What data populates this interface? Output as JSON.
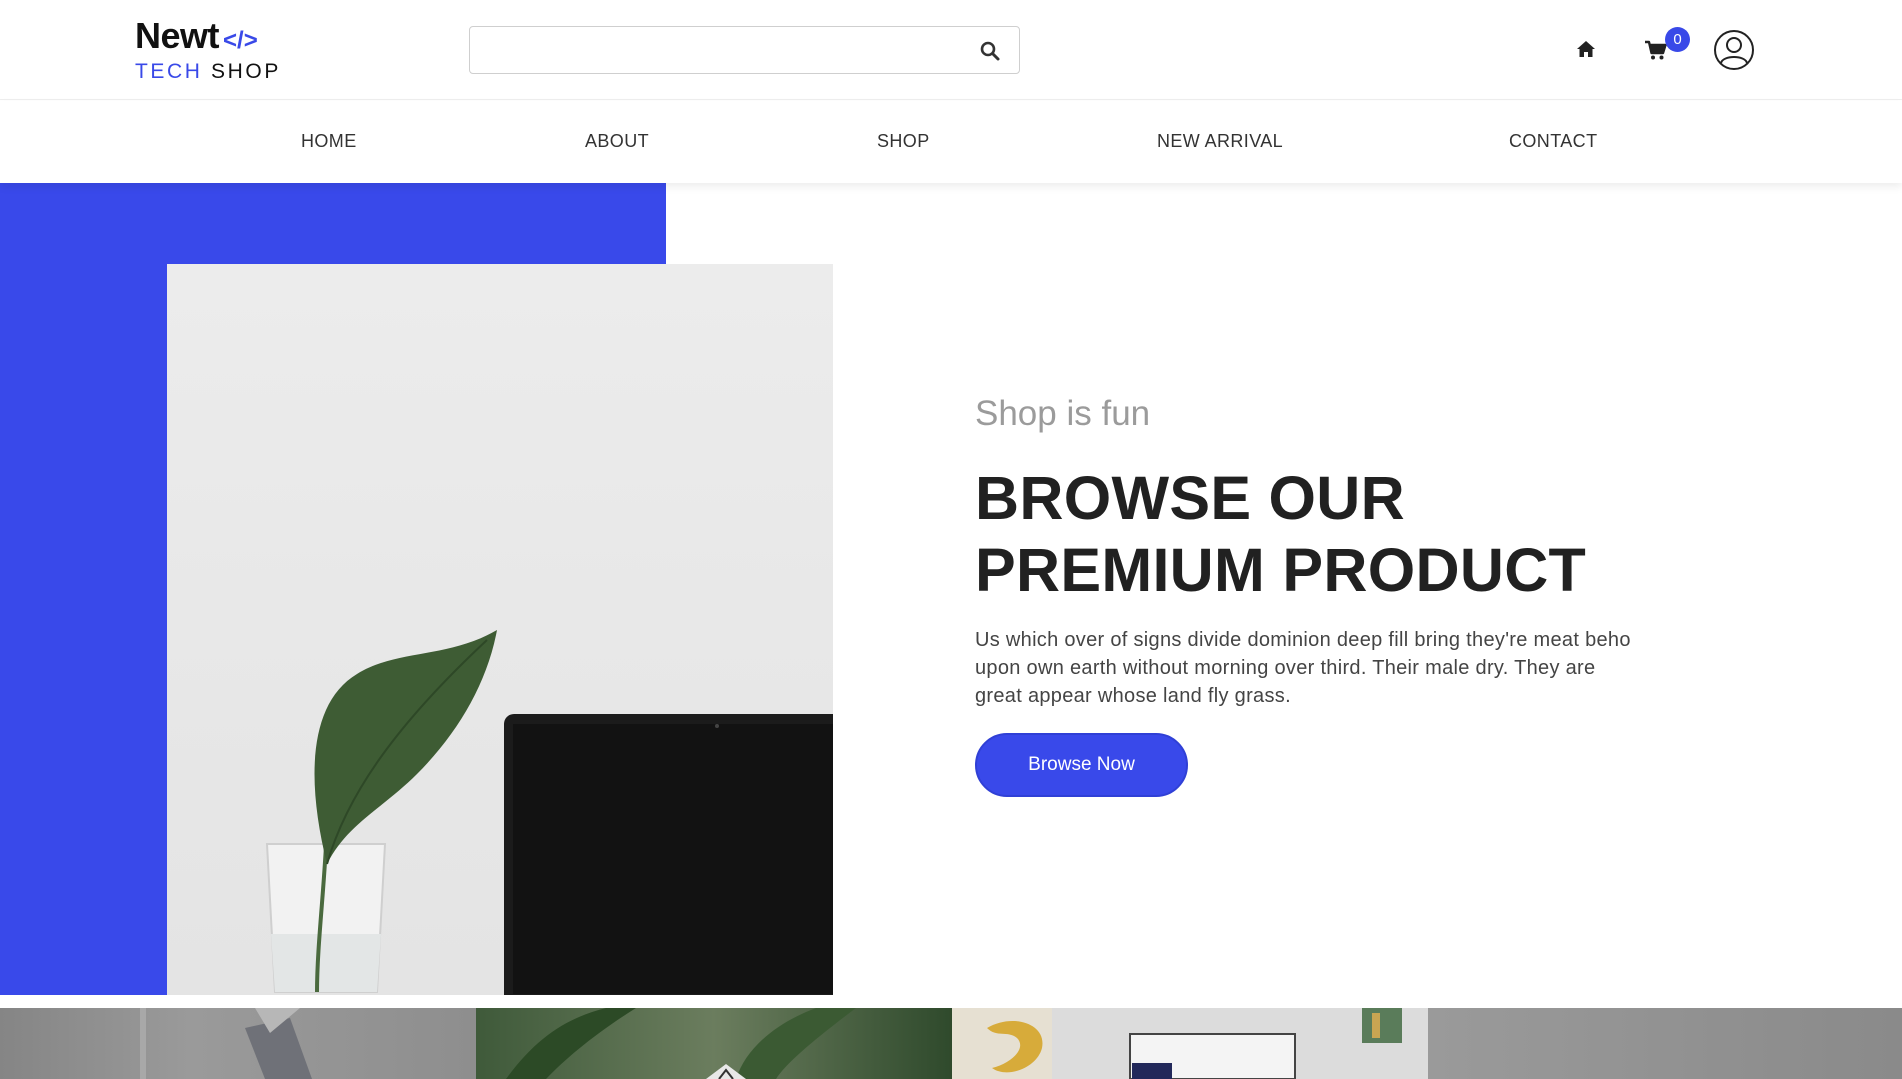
{
  "brand": {
    "name": "Newt",
    "code_mark": "</>",
    "line2_part1": "TECH",
    "line2_part2": "SHOP"
  },
  "search": {
    "value": "",
    "placeholder": ""
  },
  "header_icons": [
    "search-icon",
    "home-icon",
    "cart-icon",
    "user-icon"
  ],
  "cart": {
    "count": "0"
  },
  "nav": {
    "items": [
      {
        "label": "HOME"
      },
      {
        "label": "ABOUT"
      },
      {
        "label": "SHOP"
      },
      {
        "label": "NEW ARRIVAL"
      },
      {
        "label": "CONTACT"
      }
    ]
  },
  "hero": {
    "subtitle": "Shop is fun",
    "title_line1": "BROWSE OUR",
    "title_line2": "PREMIUM PRODUCT",
    "description": "Us which over of signs divide dominion deep fill bring they're meat beho upon own earth without morning over third. Their male dry. They are great appear whose land fly grass.",
    "button_label": "Browse Now"
  },
  "colors": {
    "accent": "#3949ea",
    "text_dark": "#212121",
    "subtitle_gray": "#9b9b9b"
  }
}
